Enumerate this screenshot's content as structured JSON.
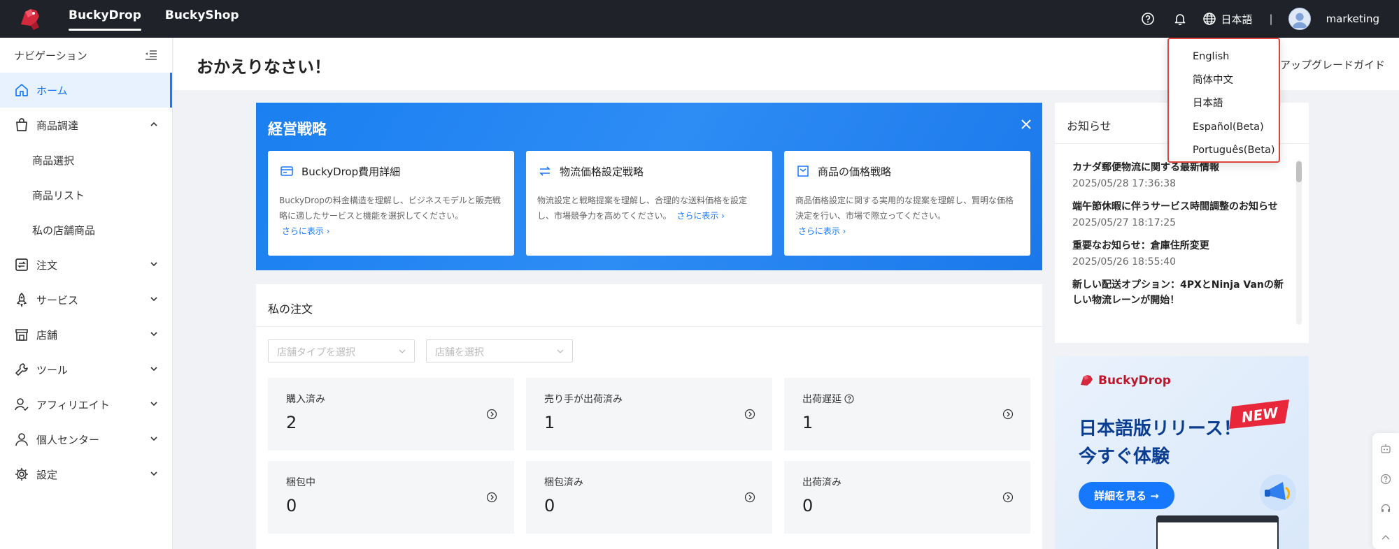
{
  "topbar": {
    "tabs": [
      "BuckyDrop",
      "BuckyShop"
    ],
    "language_label": "日本語",
    "separator": "|",
    "username": "marketing"
  },
  "sidebar": {
    "title": "ナビゲーション",
    "items": {
      "home": "ホーム",
      "sourcing": "商品調達",
      "order": "注文",
      "service": "サービス",
      "store": "店舗",
      "tools": "ツール",
      "affiliate": "アフィリエイト",
      "personal": "個人センター",
      "settings": "設定"
    },
    "sub_items": [
      "商品選択",
      "商品リスト",
      "私の店舗商品"
    ]
  },
  "page": {
    "greeting": "おかえりなさい！",
    "upgrade_guide": "アップグレードガイド"
  },
  "strategy": {
    "title": "経営戦略",
    "more_label": "さらに表示",
    "cards": [
      {
        "title": "BuckyDrop費用詳細",
        "desc": "BuckyDropの料金構造を理解し、ビジネスモデルと販売戦略に適したサービスと機能を選択してください。"
      },
      {
        "title": "物流価格設定戦略",
        "desc": "物流設定と戦略提案を理解し、合理的な送料価格を設定し、市場競争力を高めてください。"
      },
      {
        "title": "商品の価格戦略",
        "desc": "商品価格設定に関する実用的な提案を理解し、賢明な価格決定を行い、市場で際立ってください。"
      }
    ]
  },
  "orders": {
    "title": "私の注文",
    "store_type_placeholder": "店舗タイプを選択",
    "store_placeholder": "店舗を選択",
    "stats": [
      {
        "label": "購入済み",
        "value": "2"
      },
      {
        "label": "売り手が出荷済み",
        "value": "1"
      },
      {
        "label": "出荷遅延",
        "value": "1"
      },
      {
        "label": "梱包中",
        "value": "0"
      },
      {
        "label": "梱包済み",
        "value": "0"
      },
      {
        "label": "出荷済み",
        "value": "0"
      }
    ]
  },
  "notices": {
    "title": "お知らせ",
    "items": [
      {
        "title": "カナダ郵便物流に関する最新情報",
        "date": "2025/05/28 17:36:38"
      },
      {
        "title": "端午節休暇に伴うサービス時間調整のお知らせ",
        "date": "2025/05/27 18:17:25"
      },
      {
        "title": "重要なお知らせ：倉庫住所変更",
        "date": "2025/05/26 18:55:40"
      },
      {
        "title": "新しい配送オプション：4PXとNinja Vanの新しい物流レーンが開始！",
        "date": ""
      }
    ]
  },
  "banner": {
    "brand": "BuckyDrop",
    "new_tag": "NEW",
    "headline_1": "日本語版リリース！",
    "headline_2": "今すぐ体験",
    "cta": "詳細を見る →"
  },
  "language_menu": {
    "options": [
      "English",
      "简体中文",
      "日本語",
      "Español(Beta)",
      "Português(Beta)"
    ]
  },
  "colors": {
    "topbar": "#1f2329",
    "accent": "#1677ff",
    "dropdown_highlight": "#e0433a"
  }
}
